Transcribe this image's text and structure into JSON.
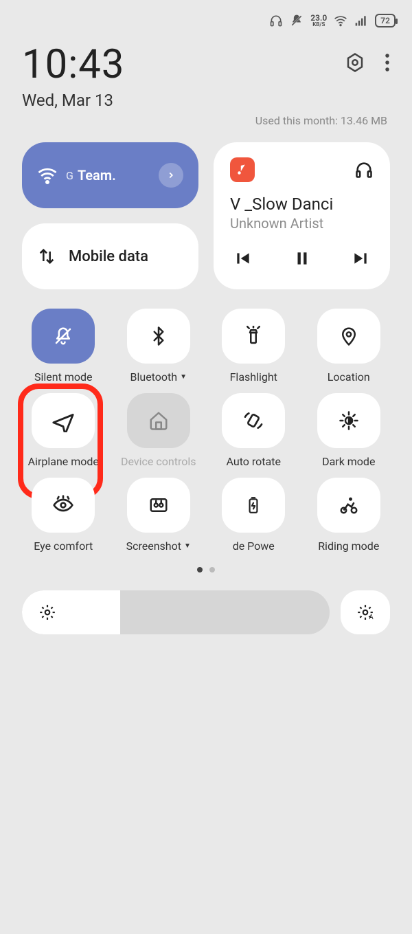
{
  "status": {
    "net_speed": "23.0",
    "net_speed_unit": "KB/S",
    "battery": "72"
  },
  "header": {
    "time": "10:43",
    "date": "Wed, Mar 13",
    "usage_label": "Used this month: 13.46 MB"
  },
  "wifi_tile": {
    "net_type": "G",
    "ssid": "Team."
  },
  "mobile_data_tile": {
    "label": "Mobile data"
  },
  "media": {
    "title": "V _Slow Danci",
    "artist": "Unknown Artist"
  },
  "tiles": [
    {
      "label": "Silent mode",
      "icon": "bell-off",
      "state": "active",
      "dropdown": false
    },
    {
      "label": "Bluetooth",
      "icon": "bluetooth",
      "state": "normal",
      "dropdown": true
    },
    {
      "label": "Flashlight",
      "icon": "flashlight",
      "state": "normal",
      "dropdown": false
    },
    {
      "label": "Location",
      "icon": "location",
      "state": "normal",
      "dropdown": false
    },
    {
      "label": "Airplane mode",
      "icon": "airplane",
      "state": "normal",
      "dropdown": false,
      "highlight": true
    },
    {
      "label": "Device controls",
      "icon": "home",
      "state": "muted",
      "dropdown": false
    },
    {
      "label": "Auto rotate",
      "icon": "rotate",
      "state": "normal",
      "dropdown": false
    },
    {
      "label": "Dark mode",
      "icon": "dark",
      "state": "normal",
      "dropdown": false
    },
    {
      "label": "Eye comfort",
      "icon": "eye",
      "state": "normal",
      "dropdown": false
    },
    {
      "label": "Screenshot",
      "icon": "screenshot",
      "state": "normal",
      "dropdown": true
    },
    {
      "label": "de    Powe",
      "icon": "battery",
      "state": "normal",
      "dropdown": false
    },
    {
      "label": "Riding mode",
      "icon": "bike",
      "state": "normal",
      "dropdown": false
    }
  ],
  "pager": {
    "pages": 2,
    "active": 0
  },
  "brightness": {
    "percent": 32
  }
}
